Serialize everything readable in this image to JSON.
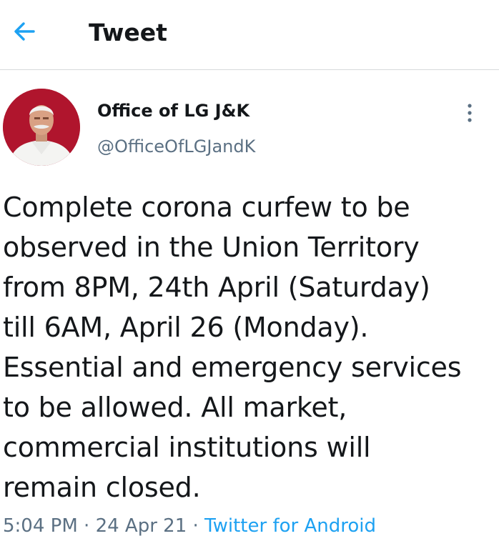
{
  "header": {
    "title": "Tweet",
    "back_icon": "arrow-left-icon",
    "accent_color": "#1da1f2"
  },
  "tweet": {
    "author": {
      "name": "Office of LG J&K",
      "handle": "@OfficeOfLGJandK",
      "avatar_icon": "profile-photo"
    },
    "more_icon": "vertical-dots-icon",
    "text": "Complete corona curfew to be\nobserved in the Union Territory\nfrom 8PM, 24th April (Saturday)\ntill 6AM, April 26 (Monday).\nEssential and emergency services\nto be allowed. All market,\ncommercial institutions will\nremain closed.",
    "time": "5:04 PM",
    "separator": "·",
    "date": "24 Apr 21",
    "source": "Twitter for Android"
  }
}
